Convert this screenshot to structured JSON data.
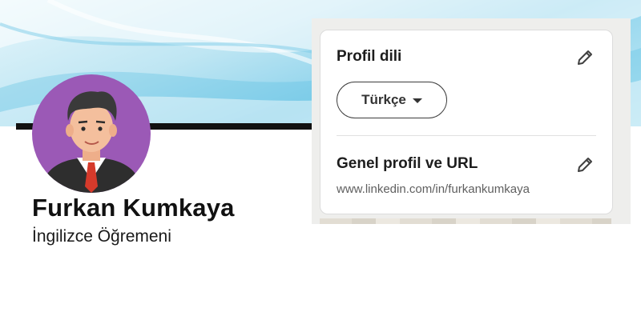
{
  "profile": {
    "name": "Furkan Kumkaya",
    "headline": "İngilizce Öğremeni"
  },
  "settings": {
    "language": {
      "title": "Profil dili",
      "current_value": "Türkçe"
    },
    "public_profile": {
      "title": "Genel profil ve URL",
      "url": "www.linkedin.com/in/furkankumkaya"
    }
  },
  "icons": {
    "edit": "pencil-icon",
    "dropdown": "caret-down-icon"
  },
  "colors": {
    "banner_accent": "#8ed3ec",
    "avatar_bg": "#9b59b6",
    "tie": "#d63a2b"
  }
}
